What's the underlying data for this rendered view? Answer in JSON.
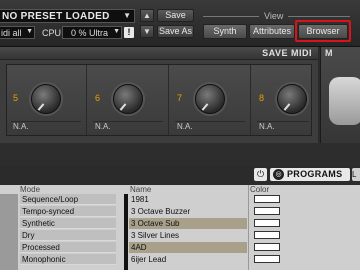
{
  "header": {
    "preset_name": "NO PRESET LOADED",
    "preset_dropdown_icon": "chevron-down-icon",
    "midi_label": "idi all",
    "cpu_label": "CPU",
    "cpu_value": "0 %",
    "cpu_mode": "Ultra",
    "warning_glyph": "!",
    "prev_arrow": "▲",
    "next_arrow": "▼",
    "save_label": "Save",
    "save_as_label": "Save As",
    "view_label": "View",
    "view_buttons": [
      "Synth",
      "Attributes",
      "Browser"
    ],
    "highlight_color": "#d8141a"
  },
  "macros": {
    "header_label": "SAVE MIDI",
    "slots": [
      {
        "num": "5",
        "value": "N.A."
      },
      {
        "num": "6",
        "value": "N.A."
      },
      {
        "num": "7",
        "value": "N.A."
      },
      {
        "num": "8",
        "value": "N.A."
      }
    ],
    "right_tab": "M"
  },
  "programs": {
    "power_glyph": "⏻",
    "label": "PROGRAMS",
    "edge_label": "L"
  },
  "browser": {
    "mode_header": "Mode",
    "modes": [
      "Sequence/Loop",
      "Tempo-synced",
      "Synthetic",
      "Dry",
      "Processed",
      "Monophonic"
    ],
    "name_header": "Name",
    "color_header": "Color",
    "rows": [
      {
        "name": "1981",
        "highlight": false
      },
      {
        "name": "3 Octave Buzzer",
        "highlight": false
      },
      {
        "name": "3 Octave Sub",
        "highlight": true
      },
      {
        "name": "3 Silver Lines",
        "highlight": false
      },
      {
        "name": "4AD",
        "highlight": true
      },
      {
        "name": "6ijer Lead",
        "highlight": false
      }
    ]
  }
}
